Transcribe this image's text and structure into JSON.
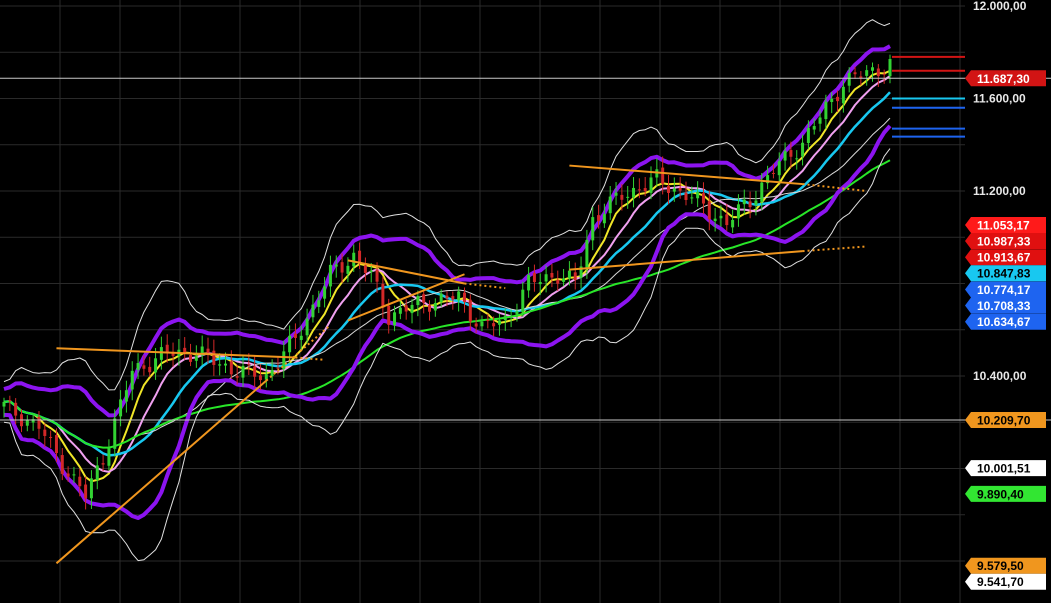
{
  "chart_data": {
    "type": "candlestick",
    "title": "",
    "xlabel": "",
    "ylabel": "",
    "ylim": [
      9520,
      12020
    ],
    "grid": true,
    "y_ticks": [
      {
        "value": 12000,
        "label": "12.000,00"
      },
      {
        "value": 11600,
        "label": "11.600,00"
      },
      {
        "value": 11200,
        "label": "11.200,00"
      },
      {
        "value": 10400,
        "label": "10.400,00"
      }
    ],
    "horizontal_lines": [
      {
        "value": 11687.3,
        "color": "#c8c8c8"
      },
      {
        "value": 10209.7,
        "color": "#c8c8c8"
      }
    ],
    "price_badges": [
      {
        "value": 11687.3,
        "label": "11.687,30",
        "bg": "#d21414",
        "fg": "#ffffff"
      },
      {
        "value": 11053.17,
        "label": "11.053,17",
        "bg": "#ff1a1a",
        "fg": "#ffffff"
      },
      {
        "value": 10987.33,
        "label": "10.987,33",
        "bg": "#e01010",
        "fg": "#ffffff"
      },
      {
        "value": 10913.67,
        "label": "10.913,67",
        "bg": "#e01010",
        "fg": "#ffffff"
      },
      {
        "value": 10847.83,
        "label": "10.847,83",
        "bg": "#18c8f0",
        "fg": "#000000"
      },
      {
        "value": 10774.17,
        "label": "10.774,17",
        "bg": "#1e64f0",
        "fg": "#ffffff"
      },
      {
        "value": 10708.33,
        "label": "10.708,33",
        "bg": "#1e64f0",
        "fg": "#ffffff"
      },
      {
        "value": 10634.67,
        "label": "10.634,67",
        "bg": "#1e64f0",
        "fg": "#ffffff"
      },
      {
        "value": 10209.7,
        "label": "10.209,70",
        "bg": "#f0961e",
        "fg": "#000000"
      },
      {
        "value": 10001.51,
        "label": "10.001,51",
        "bg": "#ffffff",
        "fg": "#000000"
      },
      {
        "value": 9890.4,
        "label": "9.890,40",
        "bg": "#32e632",
        "fg": "#000000"
      },
      {
        "value": 9579.5,
        "label": "9.579,50",
        "bg": "#f0961e",
        "fg": "#000000"
      },
      {
        "value": 9541.7,
        "label": "9.541,70",
        "bg": "#ffffff",
        "fg": "#000000"
      }
    ],
    "level_ticks": [
      {
        "value": 11780,
        "color": "#d21414"
      },
      {
        "value": 11720,
        "color": "#d21414"
      },
      {
        "value": 11600,
        "color": "#18c8f0"
      },
      {
        "value": 11560,
        "color": "#1e64f0"
      },
      {
        "value": 11470,
        "color": "#1e64f0"
      },
      {
        "value": 11435,
        "color": "#1e64f0"
      }
    ],
    "candle_count": 153,
    "anchors": [
      [
        0,
        10270
      ],
      [
        6,
        10180
      ],
      [
        10,
        10020
      ],
      [
        14,
        9880
      ],
      [
        17,
        10050
      ],
      [
        22,
        10420
      ],
      [
        28,
        10500
      ],
      [
        33,
        10500
      ],
      [
        40,
        10420
      ],
      [
        45,
        10400
      ],
      [
        50,
        10560
      ],
      [
        56,
        10840
      ],
      [
        60,
        10920
      ],
      [
        63,
        10830
      ],
      [
        66,
        10660
      ],
      [
        72,
        10720
      ],
      [
        78,
        10740
      ],
      [
        82,
        10610
      ],
      [
        86,
        10640
      ],
      [
        90,
        10800
      ],
      [
        95,
        10840
      ],
      [
        98,
        10800
      ],
      [
        101,
        11080
      ],
      [
        106,
        11180
      ],
      [
        112,
        11250
      ],
      [
        118,
        11170
      ],
      [
        124,
        11060
      ],
      [
        128,
        11160
      ],
      [
        132,
        11290
      ],
      [
        137,
        11410
      ],
      [
        140,
        11520
      ],
      [
        144,
        11670
      ],
      [
        146,
        11690
      ]
    ],
    "series": [
      {
        "name": "",
        "kind": "sma_short",
        "period": 6,
        "color": "#f0e628",
        "width": 2
      },
      {
        "name": "",
        "kind": "sma_mid",
        "period": 10,
        "color": "#f0a0f0",
        "width": 2
      },
      {
        "name": "",
        "kind": "sma_long",
        "period": 16,
        "color": "#18c8f0",
        "width": 2.5
      },
      {
        "name": "",
        "kind": "sma_slow",
        "period": 24,
        "color": "#d8d8d8",
        "width": 1
      },
      {
        "name": "",
        "kind": "sma_very_slow",
        "period": 50,
        "color": "#28e628",
        "width": 2
      },
      {
        "name": "",
        "kind": "band_inner",
        "period": 14,
        "mult": 1.4,
        "color": "#8c14f0",
        "width": 4
      },
      {
        "name": "",
        "kind": "band_outer",
        "period": 14,
        "mult": 2.2,
        "color": "#e0e0e0",
        "width": 1
      }
    ],
    "trend_lines": [
      {
        "from": [
          9,
          10520
        ],
        "to": [
          50,
          10480
        ],
        "dotted_to": [
          55,
          10470
        ],
        "color": "#f0961e"
      },
      {
        "from": [
          9,
          9590
        ],
        "to": [
          45,
          10380
        ],
        "dotted_to": [
          56,
          10620
        ],
        "color": "#f0961e"
      },
      {
        "from": [
          59,
          10900
        ],
        "to": [
          79,
          10800
        ],
        "dotted_to": [
          86,
          10780
        ],
        "color": "#f0961e"
      },
      {
        "from": [
          59,
          10640
        ],
        "to": [
          79,
          10840
        ],
        "color": "#f0961e"
      },
      {
        "from": [
          97,
          11310
        ],
        "to": [
          137,
          11230
        ],
        "dotted_to": [
          148,
          11200
        ],
        "color": "#f0961e"
      },
      {
        "from": [
          97,
          10860
        ],
        "to": [
          137,
          10940
        ],
        "dotted_to": [
          148,
          10960
        ],
        "color": "#f0961e"
      }
    ],
    "colors": {
      "background": "#000000",
      "grid": "#2a2a2a",
      "candle_up": "#32d232",
      "candle_down": "#d22828"
    }
  }
}
